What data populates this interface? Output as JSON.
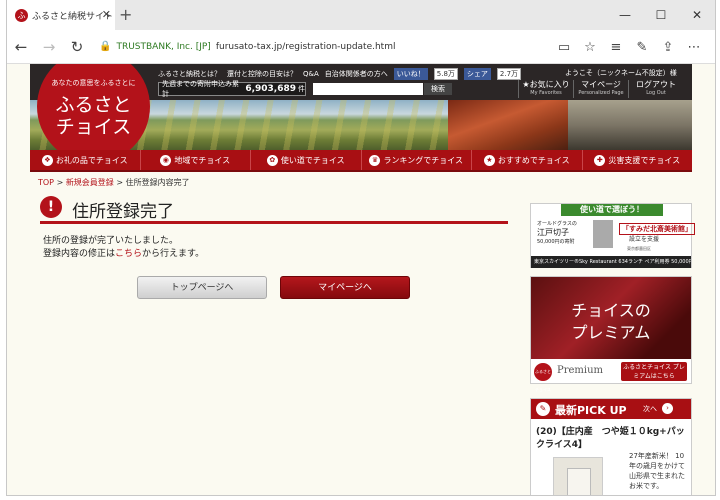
{
  "browser": {
    "tab_title": "ふるさと納税サイト [ふるさと",
    "favicon_text": "ふ",
    "url_owner": "TRUSTBANK, Inc. [JP]",
    "url": "furusato-tax.jp/registration-update.html"
  },
  "header": {
    "logo_subtitle": "あなたの意思をふるさとに",
    "logo_line1": "ふるさと",
    "logo_line2": "チョイス",
    "links": [
      "ふるさと納税とは？",
      "還付と控除の目安は？",
      "Q&A",
      "自治体関係者の方へ"
    ],
    "fb_like_label": "いいね！",
    "fb_like_count": "5.8万",
    "fb_share_label": "シェア",
    "fb_share_count": "2.7万",
    "counter_label": "先週までの寄附申込み累計",
    "counter_value": "6,903,689",
    "counter_unit": "件",
    "search_button": "検索",
    "greeting": "ようこそ（ニックネーム不設定）様",
    "member_nav": [
      {
        "label": "★お気に入り",
        "sub": "My Favorites"
      },
      {
        "label": "マイページ",
        "sub": "Personalized Page"
      },
      {
        "label": "ログアウト",
        "sub": "Log Out"
      }
    ]
  },
  "category_nav": [
    {
      "label": "お礼の品でチョイス",
      "icon": "gift-icon"
    },
    {
      "label": "地域でチョイス",
      "icon": "map-pin-icon"
    },
    {
      "label": "使い道でチョイス",
      "icon": "flower-icon"
    },
    {
      "label": "ランキングでチョイス",
      "icon": "crown-icon"
    },
    {
      "label": "おすすめでチョイス",
      "icon": "star-icon"
    },
    {
      "label": "災害支援でチョイス",
      "icon": "plus-icon"
    }
  ],
  "breadcrumb": {
    "top": "TOP",
    "step2": "新規会員登録",
    "current": "住所登録内容完了"
  },
  "page": {
    "title": "住所登録完了",
    "message_line1": "住所の登録が完了いたしました。",
    "message_line2_prefix": "登録内容の修正は",
    "message_link": "こちら",
    "message_line2_suffix": "から行えます。",
    "btn_top": "トップページへ",
    "btn_mypage": "マイページへ"
  },
  "sidebar": {
    "usage_header": "使い道で選ぼう！",
    "usage_text1": "オールドグラスの",
    "usage_text2": "江戸切子",
    "usage_text3": "50,000円の寄附",
    "usage_highlight": "「すみだ北斎美術館」",
    "usage_text4": "設立を支援",
    "usage_text5": "東京都墨田区",
    "usage_caption": "東京スカイツリー®Sky Restaurant 634ランチ ペア利用券 50,000円の寄附",
    "premium_title1": "チョイスの",
    "premium_title2": "プレミアム",
    "premium_logo": "ふるさと チョイス",
    "premium_word": "Premium",
    "premium_button": "ふるさとチョイス プレミアムはこちら",
    "pickup_title": "最新PICK UP",
    "pickup_next": "次へ",
    "pickup_item_title": "(20)【庄内産　つや姫１０kg+パッ クライス4】",
    "pickup_item_desc": "27年産新米！ 10年の歳月をかけて山形県で生まれたお米です。"
  },
  "colors": {
    "brand_red": "#b3121a",
    "header_dark": "#2b2626",
    "page_bg": "#fbfaf1"
  }
}
